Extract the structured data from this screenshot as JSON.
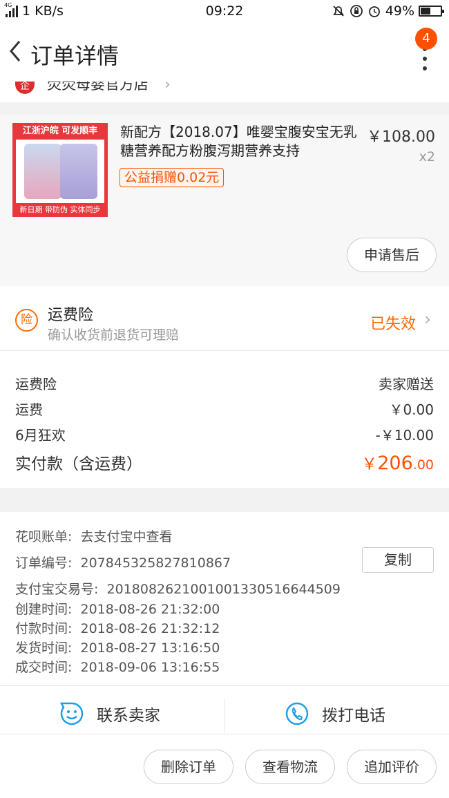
{
  "status_bar": {
    "network": "1 KB/s",
    "network_tag": "4G",
    "time": "09:22",
    "battery": "49%",
    "battery_level": 0.49
  },
  "header": {
    "title": "订单详情",
    "badge": "4"
  },
  "shop": {
    "name": "荧荧母婴官方店",
    "icon_text": "企"
  },
  "product": {
    "thumb_top": "江浙沪皖  可发顺丰",
    "thumb_bottom": "新日期 带防伪  实体同步",
    "name": "新配方【2018.07】唯婴宝腹安宝无乳糖营养配方粉腹泻期营养支持",
    "donation": "公益捐赠0.02元",
    "price": "￥108.00",
    "quantity": "x2",
    "after_sale_button": "申请售后"
  },
  "insurance": {
    "icon_text": "险",
    "title": "运费险",
    "subtitle": "确认收货前退货可理赔",
    "status": "已失效"
  },
  "fees": [
    {
      "label": "运费险",
      "value": "卖家赠送"
    },
    {
      "label": "运费",
      "value": "￥0.00"
    },
    {
      "label": "6月狂欢",
      "value": "-￥10.00"
    }
  ],
  "total": {
    "label": "实付款（含运费）",
    "currency": "￥",
    "integer": "206",
    "decimal": ".00"
  },
  "order_info": [
    {
      "label": "花呗账单:",
      "value": "去支付宝中查看"
    },
    {
      "label": "订单编号:",
      "value": "207845325827810867"
    },
    {
      "label": "支付宝交易号:",
      "value": "2018082621001001330516644509"
    },
    {
      "label": "创建时间:",
      "value": "2018-08-26 21:32:00"
    },
    {
      "label": "付款时间:",
      "value": "2018-08-26 21:32:12"
    },
    {
      "label": "发货时间:",
      "value": "2018-08-27 13:16:50"
    },
    {
      "label": "成交时间:",
      "value": "2018-09-06 13:16:55"
    }
  ],
  "copy_button": "复制",
  "contact": {
    "seller": "联系卖家",
    "phone": "拨打电话"
  },
  "actions": {
    "delete": "删除订单",
    "logistics": "查看物流",
    "review": "追加评价"
  },
  "colors": {
    "accent": "#ff5000",
    "insurance": "#ff6a00",
    "contact_icon": "#1e9fe6"
  },
  "icons": [
    "back-arrow-icon",
    "more-dots-icon",
    "shop-icon",
    "chevron-right-icon",
    "insurance-icon",
    "smile-chat-icon",
    "phone-icon"
  ]
}
